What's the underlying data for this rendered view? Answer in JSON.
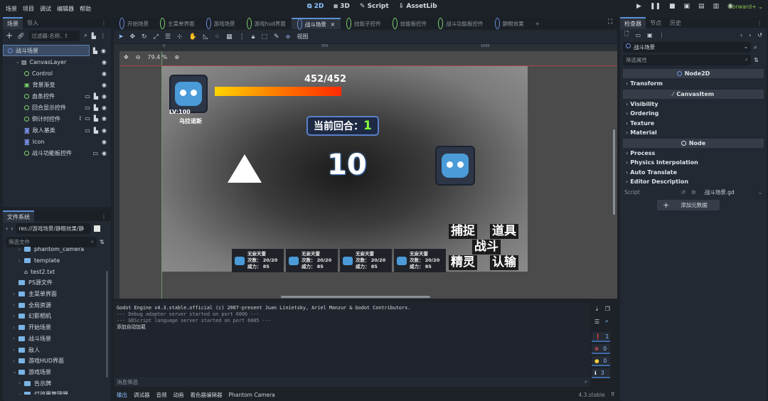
{
  "menu": [
    "场景",
    "项目",
    "调试",
    "编辑器",
    "帮助"
  ],
  "modes": [
    {
      "label": "2D",
      "icon": "2d-icon",
      "active": true
    },
    {
      "label": "3D",
      "icon": "3d-icon"
    },
    {
      "label": "Script",
      "icon": "script-icon"
    },
    {
      "label": "AssetLib",
      "icon": "assetlib-icon"
    }
  ],
  "renderer": "Forward+",
  "scene_dock": {
    "tabs": [
      "场景",
      "导入"
    ],
    "filter_placeholder": "过滤器:名称、t",
    "nodes": [
      {
        "label": "战斗场景",
        "icon": "node2d-icon",
        "depth": 0,
        "selected": true
      },
      {
        "label": "CanvasLayer",
        "icon": "canvaslayer-icon",
        "depth": 1
      },
      {
        "label": "Control",
        "icon": "control-icon",
        "depth": 2
      },
      {
        "label": "背景渐变",
        "icon": "texturerect-icon",
        "depth": 2
      },
      {
        "label": "血条控件",
        "icon": "control-icon",
        "depth": 2
      },
      {
        "label": "回合显示控件",
        "icon": "control-icon",
        "depth": 2
      },
      {
        "label": "倒计时控件",
        "icon": "control-icon",
        "depth": 2
      },
      {
        "label": "敌人基类",
        "icon": "scene-icon",
        "depth": 2
      },
      {
        "label": "Icon",
        "icon": "sprite-icon",
        "depth": 2
      },
      {
        "label": "战斗功能板控件",
        "icon": "control-icon",
        "depth": 2
      }
    ]
  },
  "filesystem": {
    "title": "文件系统",
    "path": "res://游戏场景/静眼效果/静",
    "filter_placeholder": "筛选文件",
    "items": [
      {
        "label": "phantom_camera",
        "type": "folder",
        "depth": 2
      },
      {
        "label": "template",
        "type": "folder",
        "depth": 2
      },
      {
        "label": "test2.txt",
        "type": "file",
        "depth": 2
      },
      {
        "label": "PS源文件",
        "type": "folder",
        "depth": 1
      },
      {
        "label": "主菜单界面",
        "type": "folder",
        "depth": 1
      },
      {
        "label": "全局资源",
        "type": "folder",
        "depth": 1
      },
      {
        "label": "幻影相机",
        "type": "folder",
        "depth": 1
      },
      {
        "label": "开始场景",
        "type": "folder",
        "depth": 1
      },
      {
        "label": "战斗场景",
        "type": "folder",
        "depth": 1
      },
      {
        "label": "敌人",
        "type": "folder",
        "depth": 1
      },
      {
        "label": "游戏HUD界面",
        "type": "folder",
        "depth": 1
      },
      {
        "label": "游戏场景",
        "type": "folder",
        "depth": 1
      },
      {
        "label": "告示牌",
        "type": "folder",
        "depth": 2
      },
      {
        "label": "灯效果管理器",
        "type": "folder",
        "depth": 2
      }
    ]
  },
  "doc_tabs": [
    {
      "label": "开始场景",
      "color": "blue"
    },
    {
      "label": "主菜单界面",
      "color": "green"
    },
    {
      "label": "游戏场景",
      "color": "blue"
    },
    {
      "label": "游戏hud界面",
      "color": "green"
    },
    {
      "label": "战斗场景",
      "color": "blue",
      "active": true
    },
    {
      "label": "技能子控件",
      "color": "green"
    },
    {
      "label": "技能板控件",
      "color": "green"
    },
    {
      "label": "战斗功能板控件",
      "color": "green"
    },
    {
      "label": "静眼效果",
      "color": "blue"
    }
  ],
  "toolbar": {
    "view_label": "视图",
    "zoom": "79.4 %",
    "ruler_marks": [
      "0",
      "500",
      "1000"
    ]
  },
  "game": {
    "player_level": "LV:100",
    "player_name": "乌拉诺斯",
    "hp_text": "452/452",
    "hp_fraction": 1.0,
    "round_label": "当前回合：",
    "round_value": "1",
    "countdown": "10",
    "skills": [
      {
        "name": "无妄天雷",
        "uses": "次数： 20/20",
        "power": "威力： 85"
      },
      {
        "name": "无妄天雷",
        "uses": "次数： 20/20",
        "power": "威力： 85"
      },
      {
        "name": "无妄天雷",
        "uses": "次数： 20/20",
        "power": "威力： 85"
      },
      {
        "name": "无妄天雷",
        "uses": "次数： 20/20",
        "power": "威力： 85"
      }
    ],
    "commands": {
      "capture": "捕捉",
      "item": "道具",
      "fight": "战斗",
      "spirit": "精灵",
      "surrender": "认输"
    }
  },
  "console": {
    "lines": [
      "Godot Engine v4.3.stable.official (c) 2007-present Juan Linietsky, Ariel Manzur & Godot Contributors.",
      "--- Debug adapter server started on port 6006 ---",
      "--- GDScript language server started on port 6005 ---",
      "添加自动加载"
    ],
    "filter_placeholder": "消息筛选",
    "counts": {
      "all": "1",
      "errors": "0",
      "warnings": "0",
      "info": "3"
    }
  },
  "bottom_tabs": [
    "输出",
    "调试器",
    "音频",
    "动画",
    "着色器编辑器",
    "Phantom Camera"
  ],
  "version": "4.3.stable",
  "inspector": {
    "tabs": [
      "检查器",
      "节点",
      "历史"
    ],
    "object": "战斗场景",
    "filter_placeholder": "筛选属性",
    "sections": [
      {
        "header": "Node2D",
        "items": [
          "Transform"
        ]
      },
      {
        "header": "CanvasItem",
        "items": [
          "Visibility",
          "Ordering",
          "Texture",
          "Material"
        ]
      },
      {
        "header": "Node",
        "items": [
          "Process",
          "Physics Interpolation",
          "Auto Translate",
          "Editor Description"
        ]
      }
    ],
    "script_label": "Script",
    "script_value": "战斗场景.gd",
    "add_metadata": "添加元数据"
  }
}
